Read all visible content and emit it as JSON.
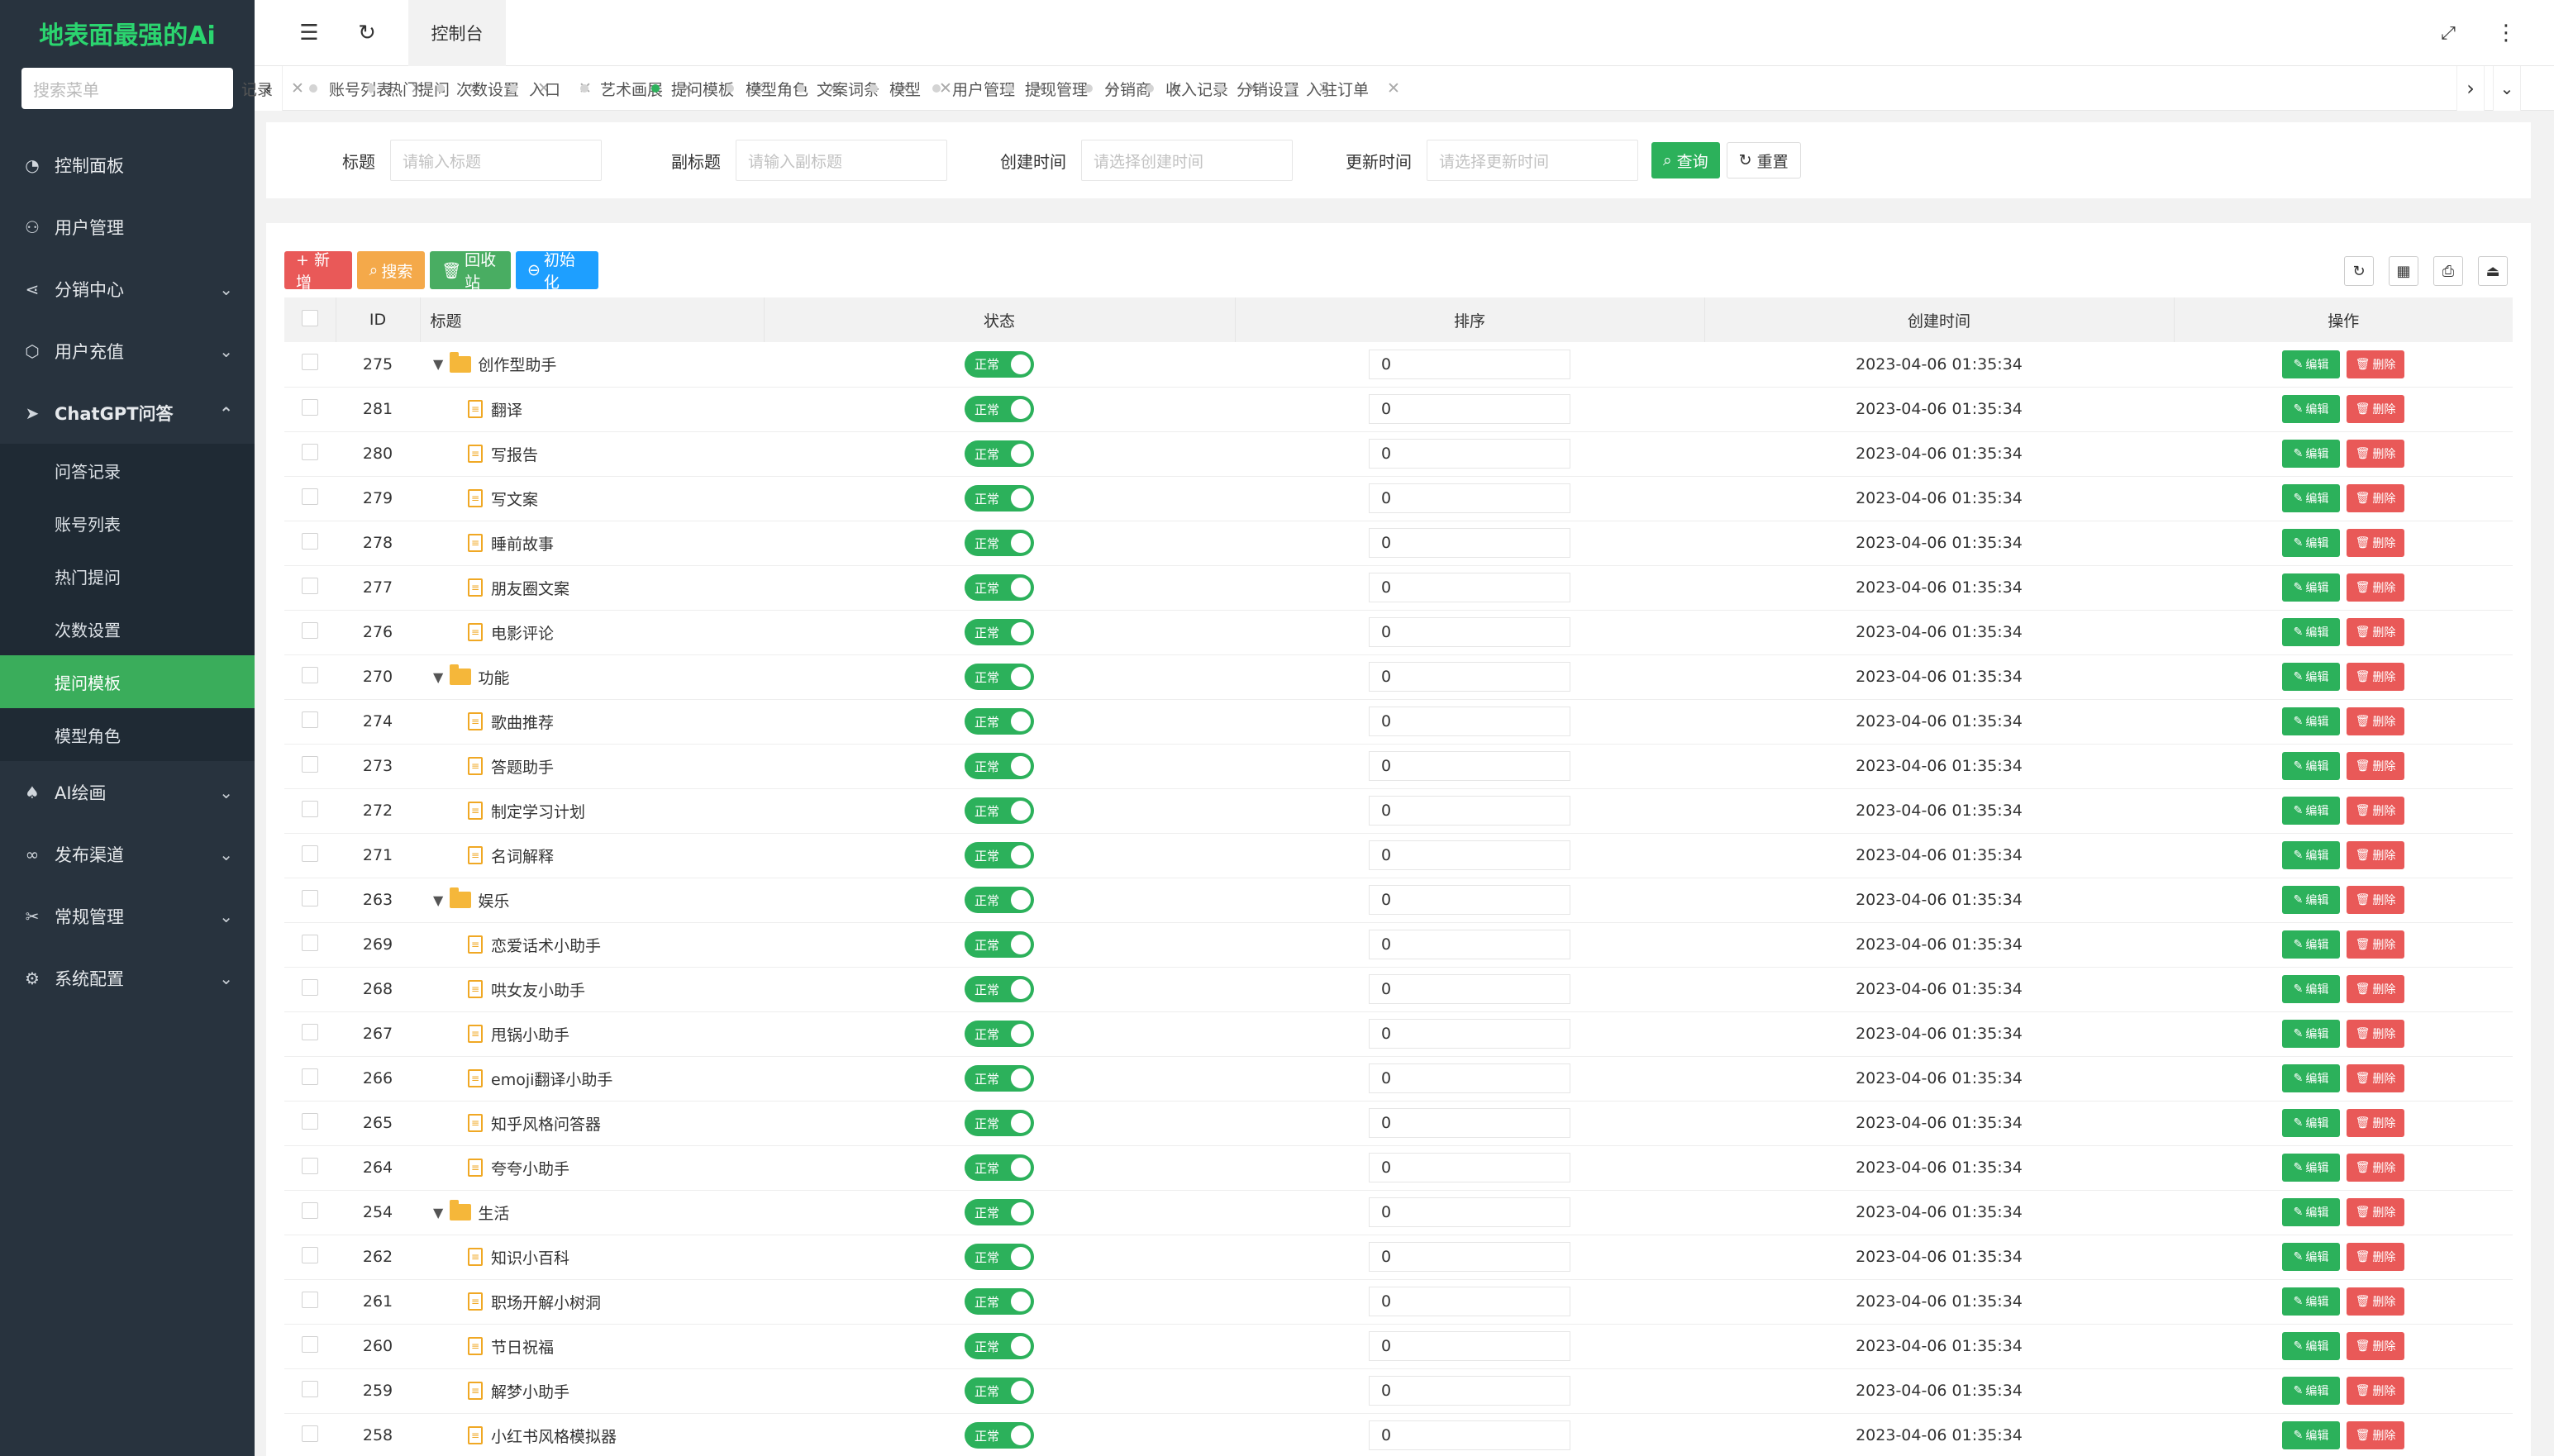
{
  "sidebar": {
    "logo": "地表面最强的Ai",
    "search_placeholder": "搜索菜单",
    "menu": [
      {
        "label": "控制面板",
        "icon": "dashboard-icon",
        "caret": false
      },
      {
        "label": "用户管理",
        "icon": "user-icon",
        "caret": false
      },
      {
        "label": "分销中心",
        "icon": "share-icon",
        "caret": true
      },
      {
        "label": "用户充值",
        "icon": "box-icon",
        "caret": true
      },
      {
        "label": "ChatGPT问答",
        "icon": "send-icon",
        "caret": true,
        "expanded": true
      }
    ],
    "submenu": [
      "问答记录",
      "账号列表",
      "热门提问",
      "次数设置",
      "提问模板",
      "模型角色"
    ],
    "active_sub": 4,
    "menu2": [
      {
        "label": "AI绘画",
        "icon": "tree-icon"
      },
      {
        "label": "发布渠道",
        "icon": "infinity-icon"
      },
      {
        "label": "常规管理",
        "icon": "tools-icon"
      },
      {
        "label": "系统配置",
        "icon": "gear-icon"
      }
    ]
  },
  "header": {
    "tab": "控制台"
  },
  "tabs": [
    "记录",
    "账号列表",
    "热门提问",
    "次数设置",
    "入口",
    "艺术画展",
    "提问模板",
    "模型角色",
    "文案词条",
    "模型",
    "用户管理",
    "提现管理",
    "分销商",
    "收入记录",
    "分销设置",
    "入驻订单"
  ],
  "active_tab": 6,
  "filter": {
    "title_label": "标题",
    "title_placeholder": "请输入标题",
    "subtitle_label": "副标题",
    "subtitle_placeholder": "请输入副标题",
    "created_label": "创建时间",
    "created_placeholder": "请选择创建时间",
    "updated_label": "更新时间",
    "updated_placeholder": "请选择更新时间",
    "query": "查询",
    "reset": "重置"
  },
  "toolbar": {
    "add": "+ 新增",
    "search": "搜索",
    "recycle": "回收站",
    "init": "初始化"
  },
  "table": {
    "headers": [
      "ID",
      "标题",
      "状态",
      "排序",
      "创建时间",
      "操作"
    ],
    "status_label": "正常",
    "edit_label": "编辑",
    "delete_label": "删除",
    "rows": [
      {
        "id": "275",
        "title": "创作型助手",
        "folder": true,
        "sort": "0",
        "created": "2023-04-06 01:35:34"
      },
      {
        "id": "281",
        "title": "翻译",
        "folder": false,
        "sort": "0",
        "created": "2023-04-06 01:35:34"
      },
      {
        "id": "280",
        "title": "写报告",
        "folder": false,
        "sort": "0",
        "created": "2023-04-06 01:35:34"
      },
      {
        "id": "279",
        "title": "写文案",
        "folder": false,
        "sort": "0",
        "created": "2023-04-06 01:35:34"
      },
      {
        "id": "278",
        "title": "睡前故事",
        "folder": false,
        "sort": "0",
        "created": "2023-04-06 01:35:34"
      },
      {
        "id": "277",
        "title": "朋友圈文案",
        "folder": false,
        "sort": "0",
        "created": "2023-04-06 01:35:34"
      },
      {
        "id": "276",
        "title": "电影评论",
        "folder": false,
        "sort": "0",
        "created": "2023-04-06 01:35:34"
      },
      {
        "id": "270",
        "title": "功能",
        "folder": true,
        "sort": "0",
        "created": "2023-04-06 01:35:34"
      },
      {
        "id": "274",
        "title": "歌曲推荐",
        "folder": false,
        "sort": "0",
        "created": "2023-04-06 01:35:34"
      },
      {
        "id": "273",
        "title": "答题助手",
        "folder": false,
        "sort": "0",
        "created": "2023-04-06 01:35:34"
      },
      {
        "id": "272",
        "title": "制定学习计划",
        "folder": false,
        "sort": "0",
        "created": "2023-04-06 01:35:34"
      },
      {
        "id": "271",
        "title": "名词解释",
        "folder": false,
        "sort": "0",
        "created": "2023-04-06 01:35:34"
      },
      {
        "id": "263",
        "title": "娱乐",
        "folder": true,
        "sort": "0",
        "created": "2023-04-06 01:35:34"
      },
      {
        "id": "269",
        "title": "恋爱话术小助手",
        "folder": false,
        "sort": "0",
        "created": "2023-04-06 01:35:34"
      },
      {
        "id": "268",
        "title": "哄女友小助手",
        "folder": false,
        "sort": "0",
        "created": "2023-04-06 01:35:34"
      },
      {
        "id": "267",
        "title": "甩锅小助手",
        "folder": false,
        "sort": "0",
        "created": "2023-04-06 01:35:34"
      },
      {
        "id": "266",
        "title": "emoji翻译小助手",
        "folder": false,
        "sort": "0",
        "created": "2023-04-06 01:35:34"
      },
      {
        "id": "265",
        "title": "知乎风格问答器",
        "folder": false,
        "sort": "0",
        "created": "2023-04-06 01:35:34"
      },
      {
        "id": "264",
        "title": "夸夸小助手",
        "folder": false,
        "sort": "0",
        "created": "2023-04-06 01:35:34"
      },
      {
        "id": "254",
        "title": "生活",
        "folder": true,
        "sort": "0",
        "created": "2023-04-06 01:35:34"
      },
      {
        "id": "262",
        "title": "知识小百科",
        "folder": false,
        "sort": "0",
        "created": "2023-04-06 01:35:34"
      },
      {
        "id": "261",
        "title": "职场开解小树洞",
        "folder": false,
        "sort": "0",
        "created": "2023-04-06 01:35:34"
      },
      {
        "id": "260",
        "title": "节日祝福",
        "folder": false,
        "sort": "0",
        "created": "2023-04-06 01:35:34"
      },
      {
        "id": "259",
        "title": "解梦小助手",
        "folder": false,
        "sort": "0",
        "created": "2023-04-06 01:35:34"
      },
      {
        "id": "258",
        "title": "小红书风格模拟器",
        "folder": false,
        "sort": "0",
        "created": "2023-04-06 01:35:34"
      }
    ]
  }
}
